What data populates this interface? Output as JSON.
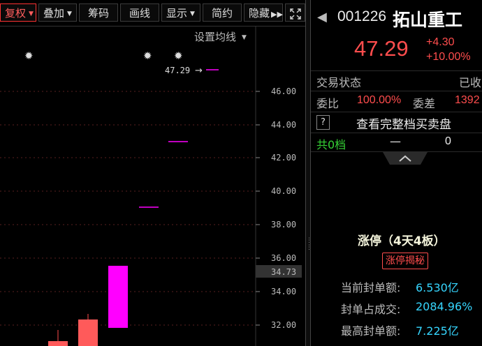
{
  "toolbar": {
    "items": [
      "复权",
      "叠加",
      "筹码",
      "画线",
      "显示",
      "简约",
      "隐藏"
    ],
    "more_icon": "double-chevron-right-icon",
    "fullscreen_icon": "expand-icon"
  },
  "chart": {
    "ma_settings_label": "设置均线",
    "price_marker": "47.29",
    "current_price_tag": "34.73",
    "y_ticks": [
      "46.00",
      "44.00",
      "42.00",
      "40.00",
      "38.00",
      "36.00",
      "34.00",
      "32.00"
    ]
  },
  "stock": {
    "code": "001226",
    "name": "拓山重工",
    "price": "47.29",
    "change": "+4.30",
    "change_pct": "+10.00%"
  },
  "trade": {
    "status_label": "交易状态",
    "status_value": "已收",
    "weibi_label": "委比",
    "weibi_value": "100.00%",
    "weicha_label": "委差",
    "weicha_value": "1392",
    "book_help": "?",
    "book_link": "查看完整档买卖盘",
    "levels_label": "共0档",
    "levels_dash": "—",
    "levels_value": "0"
  },
  "limit": {
    "title": "涨停（4天4板）",
    "reveal_button": "涨停揭秘",
    "seal_amount_label": "当前封单额:",
    "seal_amount_value": "6.530亿",
    "seal_ratio_label": "封单占成交:",
    "seal_ratio_value": "2084.96%",
    "max_seal_label": "最高封单额:",
    "max_seal_value": "7.225亿"
  },
  "colors": {
    "up": "#ff4d4d",
    "limit_up_candle": "#ff00ff",
    "cyan": "#36d6ff",
    "green": "#35d235",
    "yellow": "#ffff66"
  }
}
